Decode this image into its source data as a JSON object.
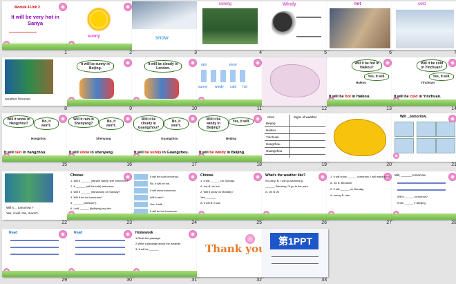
{
  "slides": [
    {
      "num": "1",
      "title": "Module 4 Unit 2",
      "subtitle": "It will be very hot in Sanya"
    },
    {
      "num": "2",
      "caption": "sunny"
    },
    {
      "num": "3",
      "caption": "snow"
    },
    {
      "num": "4",
      "caption": "raining"
    },
    {
      "num": "5",
      "caption": "Windy"
    },
    {
      "num": "6",
      "caption": "hot"
    },
    {
      "num": "7",
      "caption": "cold"
    },
    {
      "num": "8",
      "caption": "weather forecast"
    },
    {
      "num": "9",
      "bubble": "It will be sunny in Beijing."
    },
    {
      "num": "10",
      "bubble": "It will be cloudy in London."
    },
    {
      "num": "11",
      "w1": "rain",
      "w2": "snow",
      "w3": "sunny",
      "w4": "windy",
      "w5": "cold",
      "w6": "hot"
    },
    {
      "num": "12"
    },
    {
      "num": "13",
      "bubble": "Will it be hot in Haikou?",
      "reply": "Yes, it will.",
      "label": "Haikou",
      "sentence_pre": "It will be ",
      "sentence_key": "hot",
      "sentence_post": " in Haikou."
    },
    {
      "num": "14",
      "bubble": "Will it be cold in Yinchuan?",
      "reply": "Yes, it will.",
      "label": "Yinchuan",
      "sentence_pre": "It will be ",
      "sentence_key": "cold",
      "sentence_post": " in Yinchuan."
    },
    {
      "num": "15",
      "bubble": "Will it snow in Hangzhou?",
      "reply": "No, it won't.",
      "label": "Hangzhou",
      "sentence_pre": "It will ",
      "sentence_key": "rain",
      "sentence_post": " in hangzhou."
    },
    {
      "num": "16",
      "bubble": "Will it rain in Shenyang?",
      "reply": "No, it won't.",
      "label": "Shenyang",
      "sentence_pre": "It will ",
      "sentence_key": "snow",
      "sentence_post": " in shenyang."
    },
    {
      "num": "17",
      "bubble": "Will it be cloudy in Guangzhou?",
      "reply": "No, it won't.",
      "label": "Guangzhou",
      "sentence_pre": "It will ",
      "sentence_key": "be sunny",
      "sentence_post": " in Guangzhou."
    },
    {
      "num": "18",
      "bubble": "Will it be windy in Beijing?",
      "reply": "Yes, it will.",
      "label": "Beijing",
      "sentence_pre": "It will ",
      "sentence_key": "be windy",
      "sentence_post": " in Beijing."
    },
    {
      "num": "19",
      "col1": "cities",
      "col2": "Signs of weather",
      "rows": [
        "Beijing",
        "Haikou",
        "Yinchuan",
        "Hangzhou",
        "Guangzhou"
      ]
    },
    {
      "num": "20"
    },
    {
      "num": "21",
      "title": "Will ...tomorrow."
    },
    {
      "num": "22",
      "line1": "Will it ... tomorrow ?",
      "line2": "Yes, it will / No, it won't."
    },
    {
      "num": "23",
      "heading": "Choose.",
      "items": [
        "1. Will it ______ (rain/be rainy) here tomorrow?",
        "2. It ______ (will be cold) tomorrow.",
        "3. Will it ______ (rain/snow) on Sunday?",
        "4. Will it be hot tomorrow?",
        "5. ______ (will/won't)",
        "6. I will ______ (fly/flying) my kite."
      ]
    },
    {
      "num": "24",
      "items": [
        "It will be cold tomorrow.",
        "No, it will be hot.",
        "It will snow tomorrow.",
        "Will it rain?",
        "Yes, it will.",
        "It will be hot tomorrow."
      ]
    },
    {
      "num": "25",
      "heading": "Choose.",
      "items": [
        "1. It will ______ On Sunday.",
        "A. hot   B. be hot",
        "2. Will it snow on Monday?",
        "Yes, ______.",
        "A. it will   B. it can"
      ]
    },
    {
      "num": "26",
      "heading": "What's the weather like?",
      "items": [
        "It's rainy. B. I will go swimming.",
        "______ Saturday, I'll go to the park.",
        "A. On   B. At"
      ]
    },
    {
      "num": "27",
      "items": [
        "1. It will snow ______ tomorrow. I will make a snow man.",
        "A. So   B. Because",
        "2. It will ______ on Sunday.",
        "A. sunny   B. rain"
      ]
    },
    {
      "num": "28",
      "title": "Will, ______ tomorrow.",
      "items": [
        "Will it ______ tomorrow?",
        "It will ______ in Beijing."
      ]
    },
    {
      "num": "29",
      "title": "Read"
    },
    {
      "num": "30",
      "title": "Read"
    },
    {
      "num": "31",
      "heading": "Homework",
      "items": [
        "1.Read the passage.",
        "2.Write a passage about the weather.",
        "3.  It will be ______."
      ]
    },
    {
      "num": "32",
      "title": "Thank you!"
    },
    {
      "num": "33",
      "title": "第1PPT"
    }
  ],
  "colors": {
    "background": "#e4e4e4",
    "accent_red": "#dd0000",
    "title_purple": "#8b00b8"
  }
}
